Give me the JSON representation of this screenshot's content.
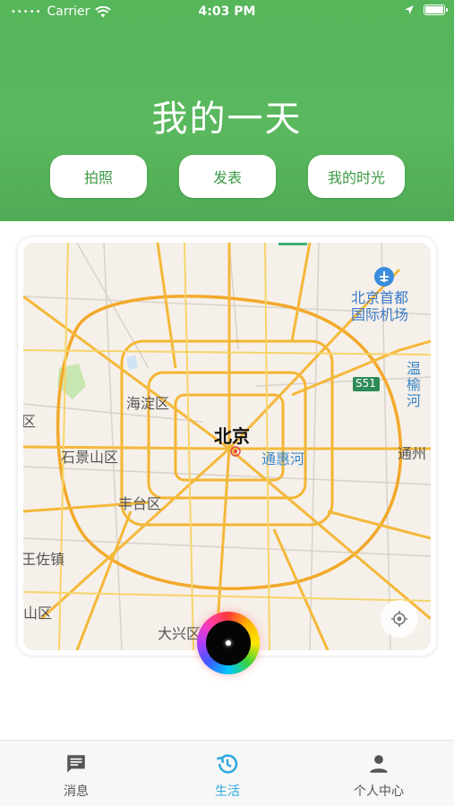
{
  "status_bar": {
    "carrier": "Carrier",
    "time": "4:03 PM"
  },
  "header": {
    "title": "我的一天",
    "background_color": "#57b65b",
    "buttons": [
      {
        "label": "拍照"
      },
      {
        "label": "发表"
      },
      {
        "label": "我的时光"
      }
    ]
  },
  "map": {
    "labels": {
      "airport": "北京首都国际机场",
      "airport_line1": "北京首都",
      "airport_line2": "国际机场",
      "haidian": "海淀区",
      "beijing": "北京",
      "tonghuihe": "通惠河",
      "shijingshan": "石景山区",
      "fengtai": "丰台区",
      "wenyuhe": "温榆河",
      "tongzhou": "通州",
      "s51": "S51",
      "wangzuo": "王佐镇",
      "shanqu": "山区",
      "daxing": "大兴区",
      "left_qu": "区"
    }
  },
  "tabbar": {
    "active_color": "#2fa8df",
    "tabs": [
      {
        "label": "消息",
        "icon": "message-icon",
        "active": false
      },
      {
        "label": "生活",
        "icon": "history-icon",
        "active": true
      },
      {
        "label": "个人中心",
        "icon": "person-icon",
        "active": false
      }
    ]
  }
}
